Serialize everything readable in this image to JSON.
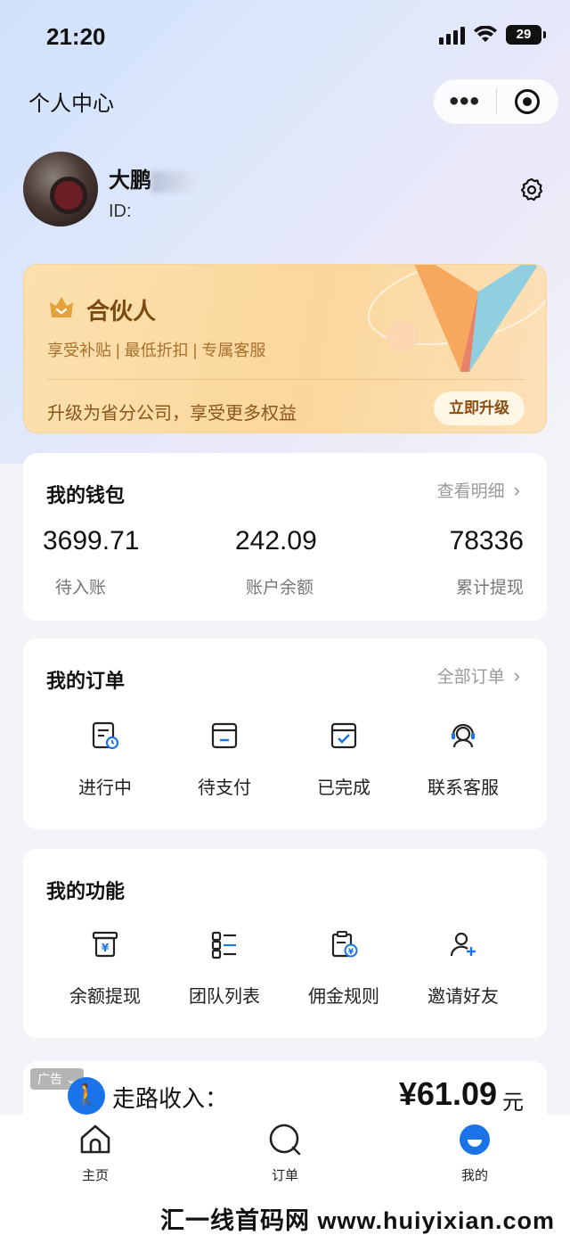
{
  "status_bar": {
    "time": "21:20",
    "battery": "29"
  },
  "nav": {
    "title": "个人中心",
    "more_label": "•••"
  },
  "profile": {
    "name": "大鹏",
    "id_prefix": "ID:"
  },
  "partner": {
    "title": "合伙人",
    "perks": "享受补贴 | 最低折扣 | 专属客服",
    "description": "升级为省分公司，享受更多权益",
    "upgrade_label": "立即升级"
  },
  "wallet": {
    "title": "我的钱包",
    "link": "查看明细",
    "items": [
      {
        "value": "3699.71",
        "label": "待入账"
      },
      {
        "value": "242.09",
        "label": "账户余额"
      },
      {
        "value": "78336",
        "label": "累计提现"
      }
    ]
  },
  "orders": {
    "title": "我的订单",
    "link": "全部订单",
    "items": [
      {
        "label": "进行中",
        "icon": "order-in-progress-icon"
      },
      {
        "label": "待支付",
        "icon": "pending-payment-icon"
      },
      {
        "label": "已完成",
        "icon": "completed-icon"
      },
      {
        "label": "联系客服",
        "icon": "customer-service-icon"
      }
    ]
  },
  "features": {
    "title": "我的功能",
    "items": [
      {
        "label": "余额提现",
        "icon": "withdraw-icon"
      },
      {
        "label": "团队列表",
        "icon": "team-list-icon"
      },
      {
        "label": "佣金规则",
        "icon": "commission-rules-icon"
      },
      {
        "label": "邀请好友",
        "icon": "invite-friend-icon"
      }
    ]
  },
  "ad": {
    "tag": "广告",
    "label": "走路收入：",
    "amount": "¥61.09",
    "unit": "元"
  },
  "tabbar": {
    "items": [
      {
        "label": "主页",
        "icon": "home-icon"
      },
      {
        "label": "订单",
        "icon": "search-order-icon"
      },
      {
        "label": "我的",
        "icon": "profile-icon"
      }
    ]
  },
  "watermark": "汇一线首码网 www.huiyixian.com",
  "colors": {
    "accent": "#1a73e8",
    "partner_gold": "#7a4a10"
  }
}
